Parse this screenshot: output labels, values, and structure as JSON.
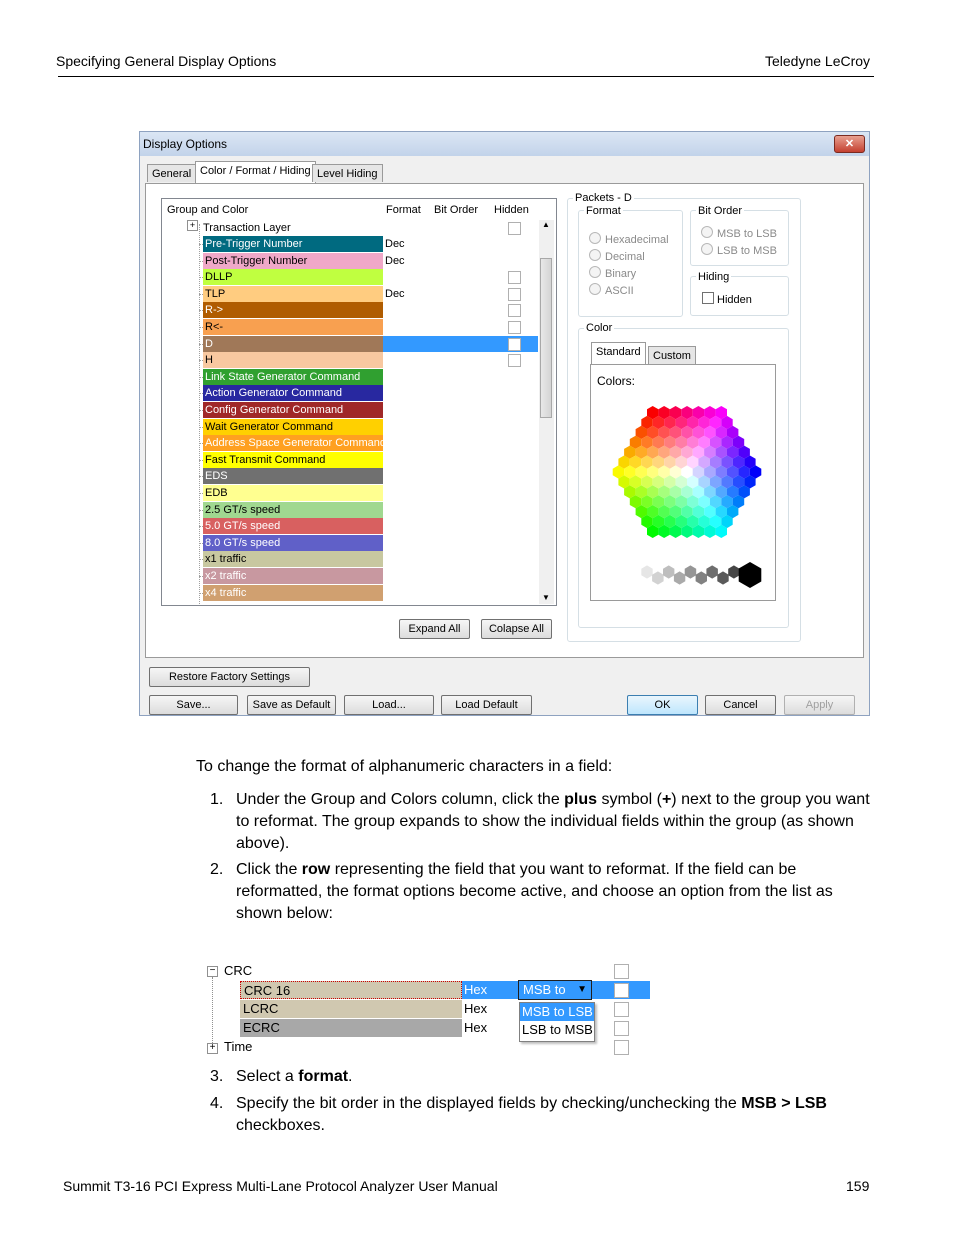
{
  "page_header": {
    "left": "Specifying General Display Options",
    "right": "Teledyne LeCroy"
  },
  "dialog": {
    "title": "Display Options",
    "close_label": "✕",
    "tabs": [
      "General",
      "Color / Format / Hiding",
      "Level Hiding"
    ],
    "grid_headers": {
      "group": "Group and Color",
      "format": "Format",
      "bit_order": "Bit Order",
      "hidden": "Hidden"
    },
    "tree_root": "Transaction Layer",
    "rows": [
      {
        "label": "Pre-Trigger Number",
        "color": "#006a80",
        "text_color": "#ffffff",
        "format": "Dec"
      },
      {
        "label": "Post-Trigger Number",
        "color": "#f0a8c8",
        "text_color": "#000000",
        "format": "Dec"
      },
      {
        "label": "DLLP",
        "color": "#c0ff40",
        "text_color": "#000000",
        "format": ""
      },
      {
        "label": "TLP",
        "color": "#ffcc80",
        "text_color": "#000000",
        "format": "Dec"
      },
      {
        "label": "R->",
        "color": "#b05c00",
        "text_color": "#ffffff",
        "format": ""
      },
      {
        "label": "R<-",
        "color": "#f8a050",
        "text_color": "#000000",
        "format": ""
      },
      {
        "label": "D",
        "color": "#a07858",
        "text_color": "#ffffff",
        "format": ""
      },
      {
        "label": "H",
        "color": "#f8c8a0",
        "text_color": "#000000",
        "format": ""
      },
      {
        "label": "Link State Generator Command",
        "color": "#30a030",
        "text_color": "#ffffff",
        "format": ""
      },
      {
        "label": "Action Generator Command",
        "color": "#2828a0",
        "text_color": "#ffffff",
        "format": ""
      },
      {
        "label": "Config Generator Command",
        "color": "#a02828",
        "text_color": "#ffffff",
        "format": ""
      },
      {
        "label": "Wait Generator Command",
        "color": "#ffd000",
        "text_color": "#000000",
        "format": ""
      },
      {
        "label": "Address Space Generator Command",
        "color": "#ffa020",
        "text_color": "#ffffff",
        "format": ""
      },
      {
        "label": "Fast Transmit Command",
        "color": "#ffff00",
        "text_color": "#000000",
        "format": ""
      },
      {
        "label": "EDS",
        "color": "#707070",
        "text_color": "#ffffff",
        "format": ""
      },
      {
        "label": "EDB",
        "color": "#ffff90",
        "text_color": "#000000",
        "format": ""
      },
      {
        "label": "2.5 GT/s speed",
        "color": "#a0d890",
        "text_color": "#000000",
        "format": ""
      },
      {
        "label": "5.0 GT/s speed",
        "color": "#d86060",
        "text_color": "#ffffff",
        "format": ""
      },
      {
        "label": "8.0 GT/s speed",
        "color": "#6060c8",
        "text_color": "#ffffff",
        "format": ""
      },
      {
        "label": "x1 traffic",
        "color": "#c8c8a0",
        "text_color": "#000000",
        "format": ""
      },
      {
        "label": "x2 traffic",
        "color": "#c898a0",
        "text_color": "#ffffff",
        "format": ""
      },
      {
        "label": "x4 traffic",
        "color": "#d0a070",
        "text_color": "#ffffff",
        "format": ""
      }
    ],
    "expand_all": "Expand All",
    "collapse_all": "Colapse All",
    "packets_label": "Packets - D",
    "format_group": "Format",
    "format_options": [
      "Hexadecimal",
      "Decimal",
      "Binary",
      "ASCII"
    ],
    "bit_order_group": "Bit Order",
    "bit_order_options": [
      "MSB to LSB",
      "LSB to MSB"
    ],
    "hiding_group": "Hiding",
    "hidden_checkbox": "Hidden",
    "color_group": "Color",
    "color_tabs": [
      "Standard",
      "Custom"
    ],
    "colors_label": "Colors:",
    "buttons": {
      "restore": "Restore Factory Settings",
      "save": "Save...",
      "save_default": "Save as Default",
      "load": "Load...",
      "load_default": "Load Default",
      "ok": "OK",
      "cancel": "Cancel",
      "apply": "Apply"
    }
  },
  "body": {
    "intro": "To change the format of alphanumeric characters in a field:",
    "steps": [
      {
        "num": "1.",
        "text_parts": [
          "Under the Group and Colors column, click the ",
          "plus",
          " symbol (",
          "+",
          ") next to the group you want to reformat. The group expands to show the individual fields within the group (as shown above)."
        ]
      },
      {
        "num": "2.",
        "text_parts": [
          "Click the ",
          "row",
          " representing the field that you want to reformat. If the field can be reformatted, the format options become active, and choose an option from the list as shown below:"
        ]
      },
      {
        "num": "3.",
        "text_parts": [
          "Select a ",
          "format",
          "."
        ]
      },
      {
        "num": "4.",
        "text_parts": [
          "Specify the bit order in the displayed fields by checking/unchecking the ",
          "MSB > LSB",
          " checkboxes."
        ]
      }
    ]
  },
  "figure2": {
    "group": "CRC",
    "rows": [
      {
        "label": "CRC 16",
        "format": "Hex"
      },
      {
        "label": "LCRC",
        "format": "Hex"
      },
      {
        "label": "ECRC",
        "format": "Hex"
      }
    ],
    "dropdown_value": "MSB to",
    "dropdown_options": [
      "MSB to LSB",
      "LSB to MSB"
    ],
    "next_group": "Time"
  },
  "footer": {
    "left": "Summit T3-16 PCI Express Multi-Lane Protocol Analyzer User Manual",
    "right": "159"
  }
}
